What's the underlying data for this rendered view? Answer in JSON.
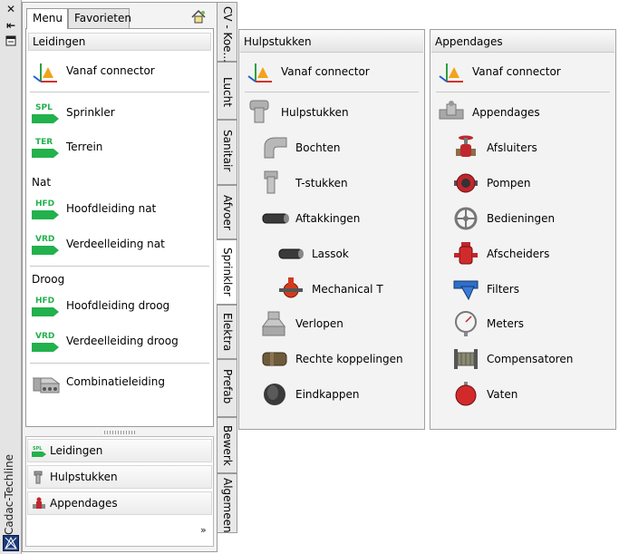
{
  "app_title": "Cadac-Techline",
  "main_tabs": [
    {
      "label": "Menu",
      "active": true
    },
    {
      "label": "Favorieten",
      "active": false
    }
  ],
  "sections": {
    "leidingen_header": "Leidingen",
    "nat_label": "Nat",
    "droog_label": "Droog"
  },
  "main_items": [
    {
      "label": "Vanaf connector",
      "icon": "connector-icon"
    },
    {
      "label": "Sprinkler",
      "icon": "spl-icon",
      "badge": "SPL"
    },
    {
      "label": "Terrein",
      "icon": "ter-icon",
      "badge": "TER"
    },
    {
      "label": "Hoofdleiding nat",
      "icon": "hfd-icon",
      "badge": "HFD"
    },
    {
      "label": "Verdeelleiding nat",
      "icon": "vrd-icon",
      "badge": "VRD"
    },
    {
      "label": "Hoofdleiding droog",
      "icon": "hfd-icon",
      "badge": "HFD"
    },
    {
      "label": "Verdeelleiding droog",
      "icon": "vrd-icon",
      "badge": "VRD"
    },
    {
      "label": "Combinatieleiding",
      "icon": "combination-pipe-icon"
    }
  ],
  "mini_list": [
    {
      "label": "Leidingen",
      "icon": "spl-small-icon",
      "badge": "SPL"
    },
    {
      "label": "Hulpstukken",
      "icon": "fitting-small-icon"
    },
    {
      "label": "Appendages",
      "icon": "valve-small-icon"
    }
  ],
  "more_glyph": "»",
  "vertical_tabs": [
    {
      "label": "CV - Koe...",
      "active": false
    },
    {
      "label": "Lucht",
      "active": false
    },
    {
      "label": "Sanitair",
      "active": false
    },
    {
      "label": "Afvoer",
      "active": false
    },
    {
      "label": "Sprinkler",
      "active": true
    },
    {
      "label": "Elektra",
      "active": false
    },
    {
      "label": "Prefab",
      "active": false
    },
    {
      "label": "Bewerk",
      "active": false
    },
    {
      "label": "Algemeen",
      "active": false
    }
  ],
  "hulpstukken": {
    "title": "Hulpstukken",
    "items": [
      {
        "label": "Vanaf connector",
        "icon": "connector-icon"
      },
      {
        "label": "Hulpstukken",
        "icon": "tee-fitting-icon"
      },
      {
        "label": "Bochten",
        "icon": "elbow-icon"
      },
      {
        "label": "T-stukken",
        "icon": "tee-icon"
      },
      {
        "label": "Aftakkingen",
        "icon": "branch-icon"
      },
      {
        "label": "Lassok",
        "icon": "weld-socket-icon"
      },
      {
        "label": "Mechanical T",
        "icon": "mechanical-tee-icon"
      },
      {
        "label": "Verlopen",
        "icon": "reducer-icon"
      },
      {
        "label": "Rechte koppelingen",
        "icon": "coupling-icon"
      },
      {
        "label": "Eindkappen",
        "icon": "end-cap-icon"
      }
    ]
  },
  "appendages": {
    "title": "Appendages",
    "items": [
      {
        "label": "Vanaf connector",
        "icon": "connector-icon"
      },
      {
        "label": "Appendages",
        "icon": "appendage-icon"
      },
      {
        "label": "Afsluiters",
        "icon": "valve-icon"
      },
      {
        "label": "Pompen",
        "icon": "pump-icon"
      },
      {
        "label": "Bedieningen",
        "icon": "handwheel-icon"
      },
      {
        "label": "Afscheiders",
        "icon": "separator-icon"
      },
      {
        "label": "Filters",
        "icon": "filter-icon"
      },
      {
        "label": "Meters",
        "icon": "gauge-icon"
      },
      {
        "label": "Compensatoren",
        "icon": "compensator-icon"
      },
      {
        "label": "Vaten",
        "icon": "vessel-icon"
      }
    ]
  },
  "colors": {
    "badge_green": "#22b14c",
    "pipe_grey": "#9c9c9c",
    "valve_red": "#c0262d",
    "filter_blue": "#2f6fc8"
  }
}
